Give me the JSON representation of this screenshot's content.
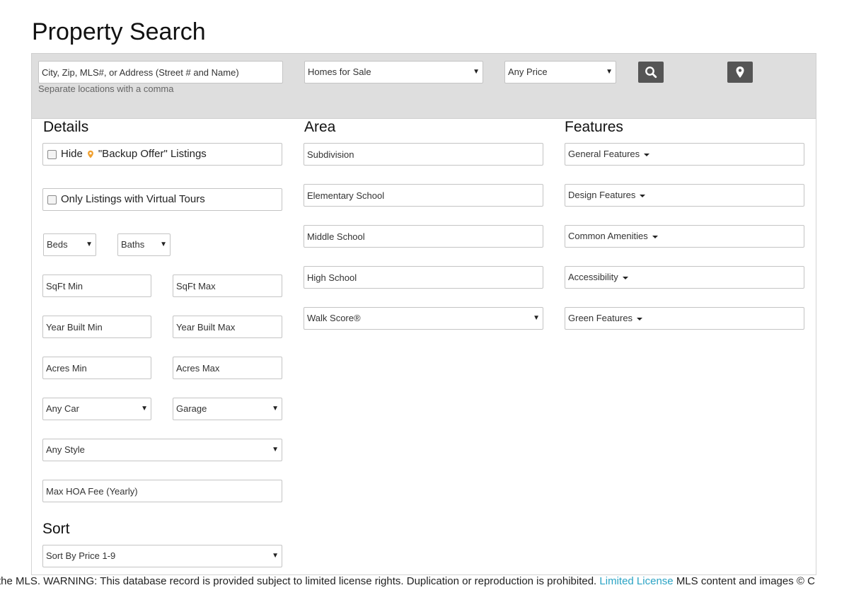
{
  "page_title": "Property Search",
  "search": {
    "location_placeholder": "City, Zip, MLS#, or Address (Street # and Name)",
    "hint": "Separate locations with a comma",
    "type_value": "Homes for Sale",
    "price_value": "Any Price"
  },
  "details": {
    "heading": "Details",
    "hide_backup_pre": "Hide",
    "hide_backup_post": "\"Backup Offer\" Listings",
    "virtual_tours": "Only Listings with Virtual Tours",
    "beds": "Beds",
    "baths": "Baths",
    "sqft_min": "SqFt Min",
    "sqft_max": "SqFt Max",
    "year_min": "Year Built Min",
    "year_max": "Year Built Max",
    "acres_min": "Acres Min",
    "acres_max": "Acres Max",
    "car": "Any Car",
    "garage": "Garage",
    "style": "Any Style",
    "hoa": "Max HOA Fee (Yearly)"
  },
  "area": {
    "heading": "Area",
    "subdivision": "Subdivision",
    "elementary": "Elementary School",
    "middle": "Middle School",
    "high": "High School",
    "walk_score": "Walk Score®"
  },
  "features": {
    "heading": "Features",
    "general": "General Features",
    "design": "Design Features",
    "common": "Common Amenities",
    "accessibility": "Accessibility",
    "green": "Green Features"
  },
  "sort": {
    "heading": "Sort",
    "value": "Sort By Price 1-9"
  },
  "footer": {
    "text": "the MLS. WARNING: This database record is provided subject to limited license rights. Duplication or reproduction is prohibited.",
    "link": "Limited License",
    "text2": "MLS content and images © C"
  },
  "colors": {
    "accent_link": "#2aa3c4",
    "button_bg": "#555555",
    "pin_orange": "#f0a030",
    "searchbar_bg": "#dedede"
  }
}
